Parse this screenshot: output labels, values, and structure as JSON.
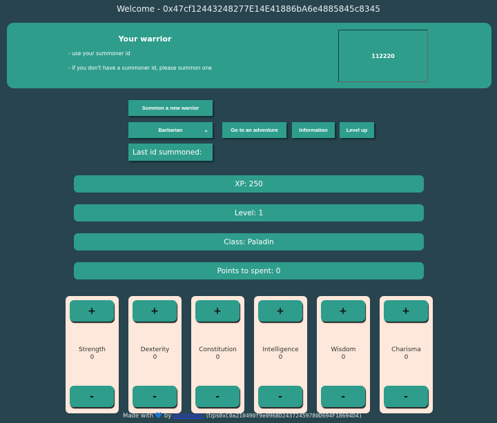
{
  "header": {
    "welcome": "Welcome - 0x47cf12443248277E14E41886bA6e4885845c8345"
  },
  "panel": {
    "title": "Your warrior",
    "hint1": "- use your summoner id",
    "hint2": "- if you don't have a summoner id, please summon one",
    "summoner_id": "112220"
  },
  "actions": {
    "summon": "Summon a new warrior",
    "class_select": "Barbarian",
    "adventure": "Go to an adventure",
    "information": "Information",
    "level_up": "Level up",
    "last_id": "Last id summoned:"
  },
  "info": {
    "xp": "XP: 250",
    "level": "Level: 1",
    "class": "Class: Paladin",
    "points": "Points to spent: 0"
  },
  "stats": [
    {
      "name": "Strength",
      "value": "0"
    },
    {
      "name": "Dexterity",
      "value": "0"
    },
    {
      "name": "Constitution",
      "value": "0"
    },
    {
      "name": "Intelligence",
      "value": "0"
    },
    {
      "name": "Wisdom",
      "value": "0"
    },
    {
      "name": "Charisma",
      "value": "0"
    }
  ],
  "stat_buttons": {
    "plus": "+",
    "minus": "-"
  },
  "footer": {
    "made_with": "Made with",
    "heart": "💙",
    "by": "by",
    "author": "@colmano",
    "tips_prefix": "(tips",
    "tips_address": "0xC0a210490f9e0968D24372459780D694F18694D4)"
  },
  "colors": {
    "background": "#27444f",
    "accent": "#2e9d8c",
    "card": "#fde8db"
  }
}
